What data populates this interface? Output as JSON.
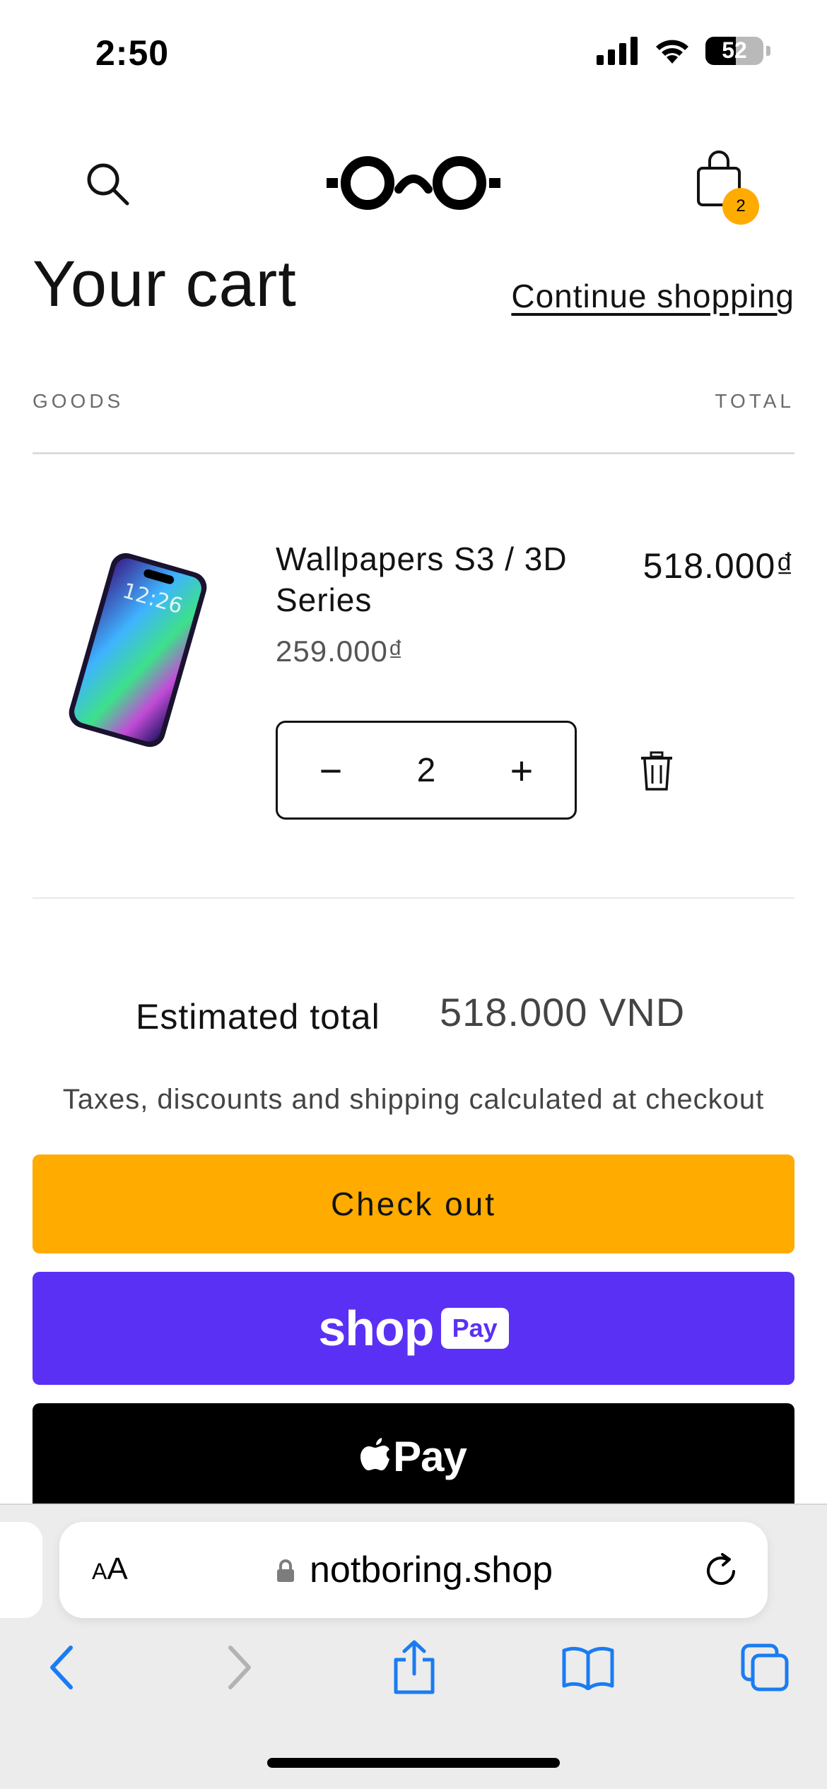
{
  "status_bar": {
    "time": "2:50",
    "battery": "52",
    "battery_level": 0.52
  },
  "header": {
    "logo_alt": "not boring logo",
    "cart_count": "2"
  },
  "page": {
    "title": "Your cart",
    "continue_label": "Continue shopping"
  },
  "columns": {
    "goods": "GOODS",
    "total": "TOTAL"
  },
  "item": {
    "name": "Wallpapers S3 / 3D Series",
    "unit_price": "259.000₫",
    "line_total": "518.000₫",
    "quantity": "2",
    "minus": "−",
    "plus": "+"
  },
  "summary": {
    "estimated_label": "Estimated total",
    "estimated_value": "518.000 VND",
    "tax_note": "Taxes, discounts and shipping calculated at checkout"
  },
  "buttons": {
    "checkout": "Check out",
    "shop_word": "shop",
    "shop_pay": "Pay",
    "apple_pay": "Pay"
  },
  "browser": {
    "aa_small": "A",
    "aa_large": "A",
    "url": "notboring.shop"
  },
  "colors": {
    "accent": "#ffab00",
    "shop_pay": "#5a31f4",
    "ios_blue": "#1a7cf2"
  }
}
